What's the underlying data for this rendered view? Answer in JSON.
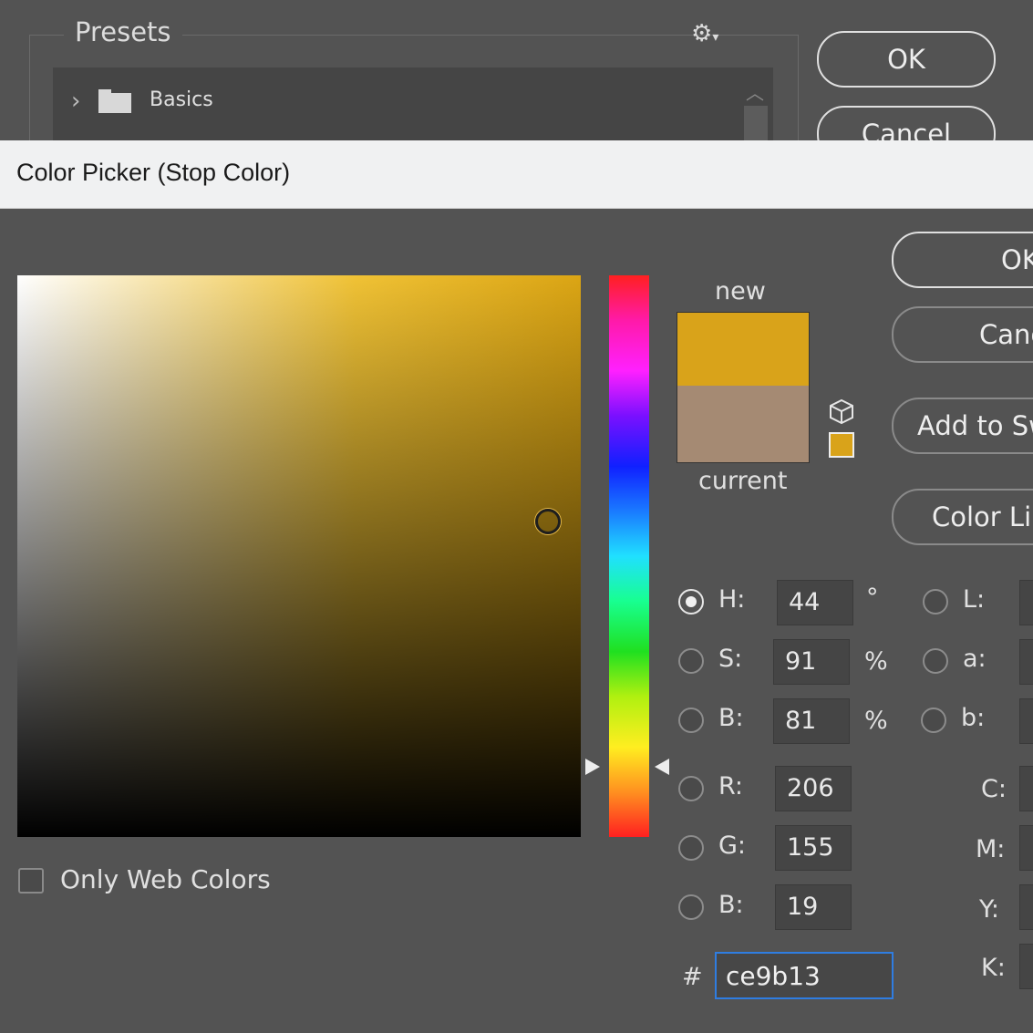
{
  "background_dialog": {
    "presets_label": "Presets",
    "tree_item_label": "Basics",
    "ok_label": "OK",
    "cancel_label": "Cancel"
  },
  "color_picker": {
    "title": "Color Picker (Stop Color)",
    "new_label": "new",
    "current_label": "current",
    "new_color": "#d9a31a",
    "current_color": "#a58a73",
    "buttons": {
      "ok": "OK",
      "cancel": "Canc",
      "add_to_swatches": "Add to Sw",
      "color_libraries": "Color Lib"
    },
    "fields": {
      "hsb": {
        "h_label": "H:",
        "h_value": "44",
        "h_unit": "°",
        "s_label": "S:",
        "s_value": "91",
        "s_unit": "%",
        "b_label": "B:",
        "b_value": "81",
        "b_unit": "%"
      },
      "rgb": {
        "r_label": "R:",
        "r_value": "206",
        "g_label": "G:",
        "g_value": "155",
        "b_label": "B:",
        "b_value": "19"
      },
      "lab": {
        "l_label": "L:",
        "a_label": "a:",
        "b_label": "b:"
      },
      "cmyk": {
        "c_label": "C:",
        "m_label": "M:",
        "y_label": "Y:",
        "k_label": "K:"
      },
      "selected_mode": "H"
    },
    "hex_hash": "#",
    "hex_value": "ce9b13",
    "only_web_colors_label": "Only Web Colors",
    "only_web_colors_checked": false
  }
}
